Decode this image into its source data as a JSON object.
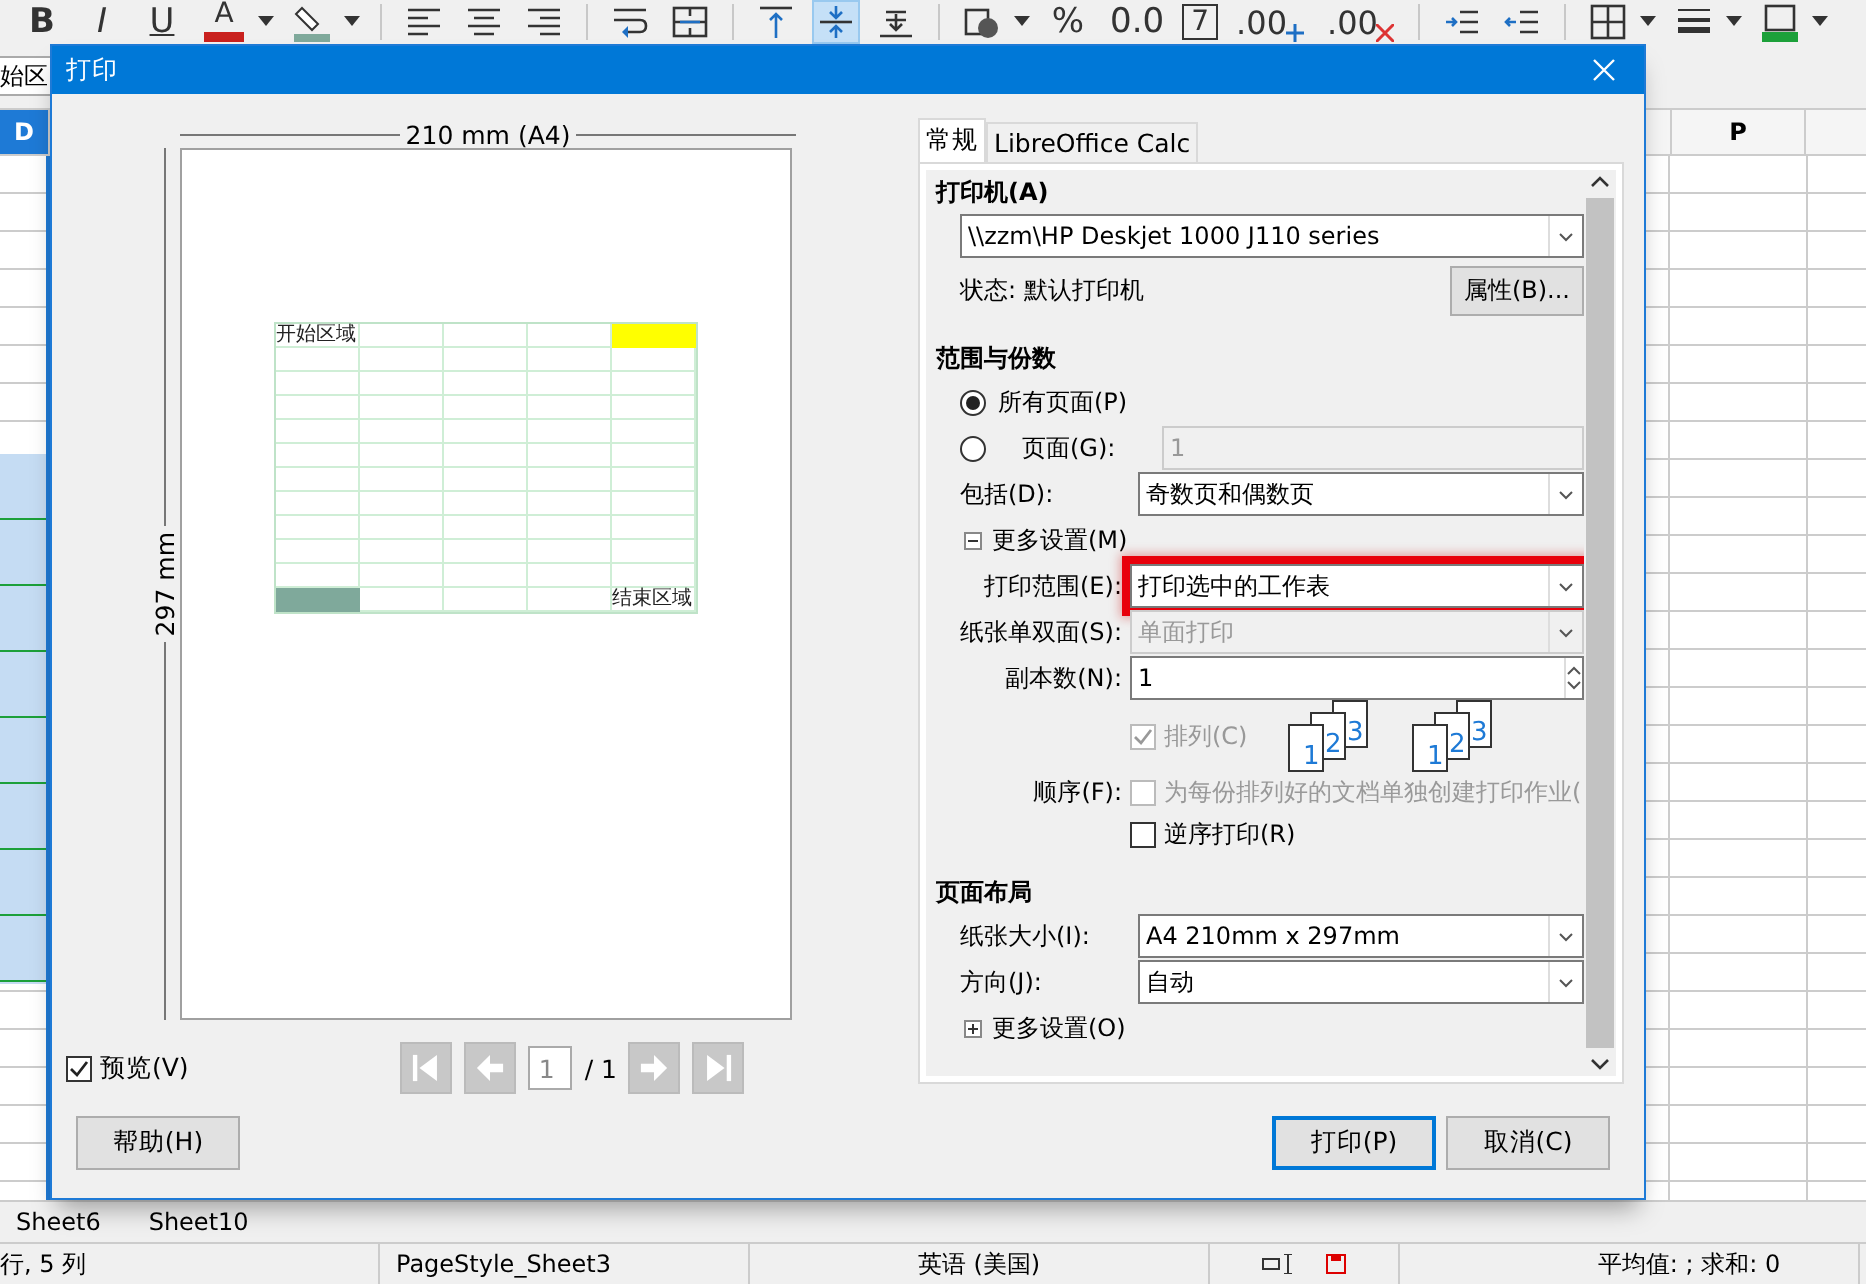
{
  "spreadsheet": {
    "toolbar": [
      {
        "kind": "bold",
        "label": "B",
        "selected": false
      },
      {
        "kind": "italic",
        "label": "I",
        "selected": false
      },
      {
        "kind": "underline",
        "label": "U",
        "selected": false
      },
      {
        "kind": "color-text",
        "label": "A",
        "color": "#c9211e",
        "selected": false
      },
      {
        "kind": "caret"
      },
      {
        "kind": "icon",
        "selected": false
      },
      {
        "kind": "caret"
      },
      {
        "kind": "separator"
      },
      {
        "kind": "icon",
        "selected": false
      },
      {
        "kind": "icon",
        "selected": false
      },
      {
        "kind": "icon",
        "selected": false
      },
      {
        "kind": "separator"
      },
      {
        "kind": "icon",
        "selected": false
      },
      {
        "kind": "icon",
        "selected": false
      },
      {
        "kind": "separator"
      },
      {
        "kind": "icon",
        "selected": false
      },
      {
        "kind": "icon",
        "selected": true
      },
      {
        "kind": "icon",
        "selected": false
      },
      {
        "kind": "separator"
      },
      {
        "kind": "icon",
        "selected": false
      },
      {
        "kind": "caret"
      },
      {
        "kind": "text",
        "label": "%",
        "selected": false
      },
      {
        "kind": "text",
        "label": "0.0",
        "selected": false
      },
      {
        "kind": "boxed",
        "label": "7",
        "selected": false
      },
      {
        "kind": "decimal-add",
        "label": ".00",
        "selected": false
      },
      {
        "kind": "decimal-remove",
        "label": ".00",
        "selected": false
      },
      {
        "kind": "separator"
      },
      {
        "kind": "icon",
        "selected": false
      },
      {
        "kind": "icon",
        "selected": false
      },
      {
        "kind": "separator"
      },
      {
        "kind": "icon",
        "selected": false
      },
      {
        "kind": "caret"
      },
      {
        "kind": "icon",
        "selected": false
      },
      {
        "kind": "caret"
      },
      {
        "kind": "icon",
        "selected": false
      },
      {
        "kind": "caret"
      }
    ],
    "name_box": "始区",
    "column_headers": [
      {
        "label": "D",
        "selected": true
      },
      {
        "label": "P",
        "selected": false
      }
    ],
    "sheet_tabs": [
      {
        "label": "Sheet6"
      },
      {
        "label": "Sheet10"
      }
    ],
    "status_bar": [
      "行, 5 列",
      "PageStyle_Sheet3",
      "英语 (美国)",
      "平均值: ; 求和: 0"
    ]
  },
  "dialog": {
    "title": "打印",
    "preview": {
      "width_label": "210 mm (A4)",
      "height_label": "297 mm",
      "marked_cells": [
        {
          "text": "开始区域"
        },
        {
          "color": "#ffff00"
        },
        {
          "color": "#7fa99b"
        },
        {
          "text": "结束区域"
        }
      ],
      "show_preview": {
        "label": "预览(V)",
        "checked": true
      },
      "page_field": "1",
      "page_total": "/ 1"
    },
    "tabs": [
      {
        "label": "常规",
        "selected": true
      },
      {
        "label": "LibreOffice Calc",
        "selected": false
      }
    ],
    "sections": [
      {
        "title": "打印机(A)",
        "rows": [
          {
            "kind": "combo",
            "value": "\\\\zzm\\HP Deskjet 1000 J110 series",
            "disabled": false,
            "highlighted": false
          },
          {
            "kind": "status",
            "text": "状态:  默认打印机",
            "button": "属性(B)..."
          }
        ]
      },
      {
        "title": "范围与份数",
        "rows": [
          {
            "kind": "radio",
            "label": "所有页面(P)",
            "selected": true
          },
          {
            "kind": "radio",
            "label": "页面(G):",
            "selected": false,
            "field": "1"
          },
          {
            "kind": "combo",
            "label": "包括(D):",
            "value": "奇数页和偶数页",
            "disabled": false,
            "highlighted": false
          },
          {
            "kind": "expander",
            "label": "更多设置(M)",
            "expanded": true
          },
          {
            "kind": "sub-combo",
            "label": "打印范围(E):",
            "value": "打印选中的工作表",
            "disabled": false,
            "highlighted": true
          },
          {
            "kind": "sub-combo",
            "label": "纸张单双面(S):",
            "value": "单面打印",
            "disabled": true,
            "highlighted": false
          },
          {
            "kind": "sub-spin",
            "label": "副本数(N):",
            "value": "1"
          },
          {
            "kind": "collate",
            "label": "排列(C)",
            "checked": true,
            "disabled": true,
            "icons": [
              {
                "pages": [
                  "1",
                  "2",
                  "3"
                ]
              },
              {
                "pages": [
                  "1",
                  "2",
                  "3"
                ]
              }
            ]
          },
          {
            "kind": "sub-check",
            "label": "顺序(F):",
            "text": "为每份排列好的文档单独创建打印作业(",
            "checked": false,
            "disabled": true
          },
          {
            "kind": "check",
            "text": "逆序打印(R)",
            "checked": false,
            "disabled": false
          }
        ]
      },
      {
        "title": "页面布局",
        "rows": [
          {
            "kind": "combo",
            "label": "纸张大小(I):",
            "value": "A4 210mm x 297mm",
            "disabled": false,
            "highlighted": false
          },
          {
            "kind": "combo",
            "label": "方向(J):",
            "value": "自动",
            "disabled": false,
            "highlighted": false
          },
          {
            "kind": "expander",
            "label": "更多设置(O)",
            "expanded": false
          }
        ]
      }
    ],
    "buttons": [
      {
        "label": "帮助(H)",
        "default": false
      },
      {
        "label": "打印(P)",
        "default": true
      },
      {
        "label": "取消(C)",
        "default": false
      }
    ]
  }
}
